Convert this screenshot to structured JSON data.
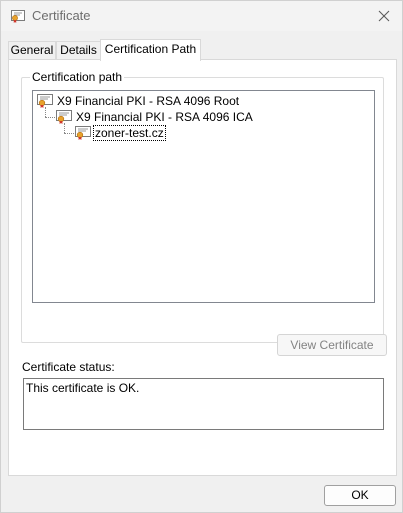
{
  "window": {
    "title": "Certificate",
    "title_icon": "certificate-icon",
    "close_icon": "close-icon"
  },
  "tabs": [
    {
      "label": "General",
      "active": false
    },
    {
      "label": "Details",
      "active": false
    },
    {
      "label": "Certification Path",
      "active": true
    }
  ],
  "certification_path": {
    "legend": "Certification path",
    "nodes": [
      {
        "label": "X9 Financial PKI - RSA 4096 Root",
        "level": 0,
        "icon": "certificate-icon"
      },
      {
        "label": "X9 Financial PKI - RSA 4096 ICA",
        "level": 1,
        "icon": "certificate-icon"
      },
      {
        "label": "zoner-test.cz",
        "level": 2,
        "icon": "certificate-icon",
        "selected": true
      }
    ],
    "view_button_label": "View Certificate"
  },
  "status": {
    "label": "Certificate status:",
    "text": "This certificate is OK."
  },
  "footer": {
    "ok_label": "OK"
  },
  "colors": {
    "cert_seal": "#e8a22c",
    "cert_paper": "#ffffff",
    "cert_border": "#7b7b7b"
  }
}
